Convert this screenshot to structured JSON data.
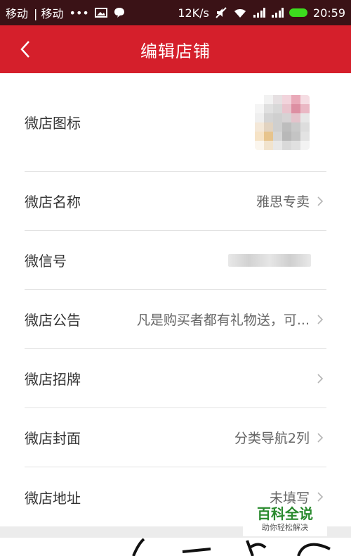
{
  "status_bar": {
    "carrier1": "移动",
    "carrier2": "| 移动",
    "dots": "•••",
    "speed": "12K/s",
    "time": "20:59",
    "icons": [
      "image-icon",
      "chat-bubble-icon",
      "mute-icon",
      "wifi-icon",
      "signal-icon",
      "signal-icon",
      "battery-icon"
    ]
  },
  "header": {
    "title": "编辑店铺",
    "back_icon": "back-arrow-icon",
    "color": "#d51f2b"
  },
  "rows": [
    {
      "label": "微店图标",
      "value": "",
      "has_chevron": false
    },
    {
      "label": "微店名称",
      "value": "雅思专卖",
      "has_chevron": true
    },
    {
      "label": "微信号",
      "value": "",
      "has_chevron": false
    },
    {
      "label": "微店公告",
      "value": "凡是购买者都有礼物送，可...",
      "has_chevron": true
    },
    {
      "label": "微店招牌",
      "value": "",
      "has_chevron": true
    },
    {
      "label": "微店封面",
      "value": "分类导航2列",
      "has_chevron": true
    },
    {
      "label": "微店地址",
      "value": "未填写",
      "has_chevron": true
    }
  ],
  "watermark": {
    "main": "百科全说",
    "sub": "助你轻松解决"
  }
}
